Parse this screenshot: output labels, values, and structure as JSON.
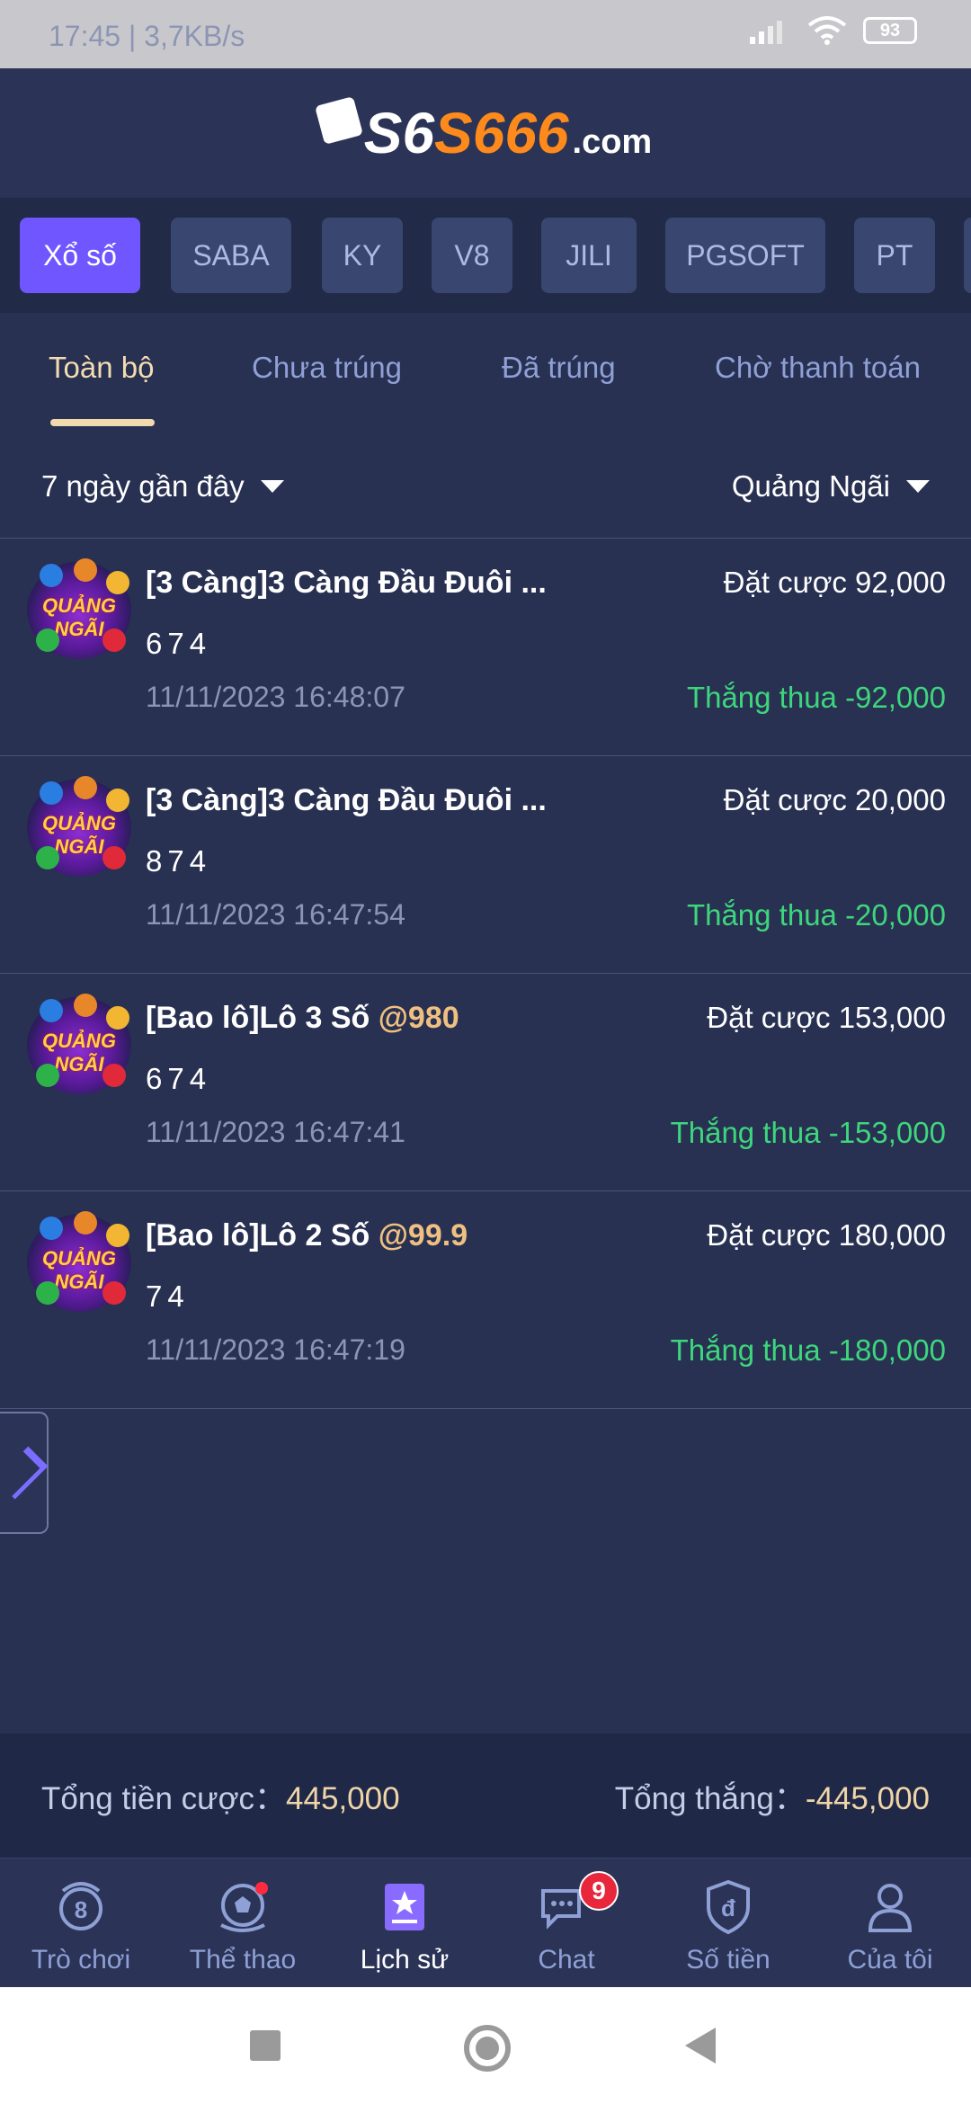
{
  "status_bar": {
    "time_speed": "17:45 | 3,7KB/s",
    "battery": "93"
  },
  "header": {
    "logo_prefix": "S6",
    "logo_main": "S666",
    "logo_suffix": ".com"
  },
  "providers": [
    "Xổ số",
    "SABA",
    "KY",
    "V8",
    "JILI",
    "PGSOFT",
    "PT"
  ],
  "status_tabs": [
    "Toàn bộ",
    "Chưa trúng",
    "Đã trúng",
    "Chờ thanh toán"
  ],
  "filters": {
    "period": "7 ngày gần đây",
    "region": "Quảng Ngãi"
  },
  "thumbnail_label": "QUẢNG NGÃI",
  "bets": [
    {
      "title": "[3 Càng]3 Càng Đầu Đuôi ...",
      "odds": "",
      "numbers": "674",
      "time": "11/11/2023 16:48:07",
      "bet": "Đặt cược 92,000",
      "result": "Thắng thua -92,000"
    },
    {
      "title": "[3 Càng]3 Càng Đầu Đuôi ...",
      "odds": "",
      "numbers": "874",
      "time": "11/11/2023 16:47:54",
      "bet": "Đặt cược 20,000",
      "result": "Thắng thua -20,000"
    },
    {
      "title": "[Bao lô]Lô 3 Số ",
      "odds": "@980",
      "numbers": "674",
      "time": "11/11/2023 16:47:41",
      "bet": "Đặt cược 153,000",
      "result": "Thắng thua -153,000"
    },
    {
      "title": "[Bao lô]Lô 2 Số ",
      "odds": "@99.9",
      "numbers": "74",
      "time": "11/11/2023 16:47:19",
      "bet": "Đặt cược 180,000",
      "result": "Thắng thua -180,000"
    }
  ],
  "totals": {
    "bet_label": "Tổng tiền cược：",
    "bet_value": "445,000",
    "win_label": "Tổng thắng：",
    "win_value": "-445,000"
  },
  "nav": [
    {
      "label": "Trò chơi",
      "icon": "dragon-icon"
    },
    {
      "label": "Thể thao",
      "icon": "soccer-ball-icon"
    },
    {
      "label": "Lịch sử",
      "icon": "history-icon"
    },
    {
      "label": "Chat",
      "icon": "chat-icon",
      "badge": "9"
    },
    {
      "label": "Số tiền",
      "icon": "wallet-shield-icon"
    },
    {
      "label": "Của tôi",
      "icon": "user-icon"
    }
  ],
  "colors": {
    "background": "#283152",
    "accent": "#6f56ff",
    "win_loss": "#3ed67c",
    "highlight": "#f0d9ad"
  }
}
